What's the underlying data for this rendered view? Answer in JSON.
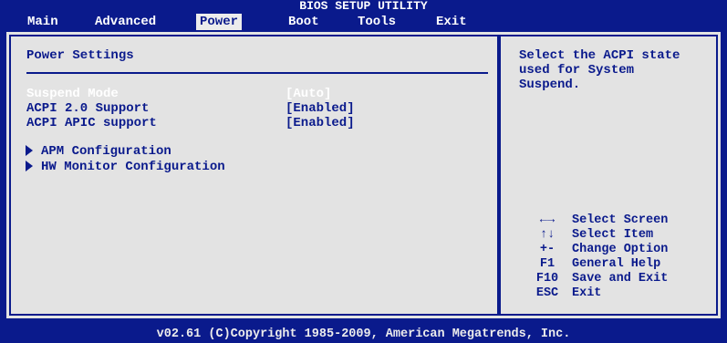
{
  "header": {
    "title": "BIOS SETUP UTILITY"
  },
  "menu": [
    {
      "label": "Main",
      "active": false
    },
    {
      "label": "Advanced",
      "active": false
    },
    {
      "label": "Power",
      "active": true
    },
    {
      "label": "Boot",
      "active": false
    },
    {
      "label": "Tools",
      "active": false
    },
    {
      "label": "Exit",
      "active": false
    }
  ],
  "main": {
    "section_title": "Power Settings",
    "settings": [
      {
        "label": "Suspend Mode",
        "value": "[Auto]",
        "selected": true
      },
      {
        "label": "ACPI 2.0 Support",
        "value": "[Enabled]",
        "selected": false
      },
      {
        "label": "ACPI APIC support",
        "value": "[Enabled]",
        "selected": false
      }
    ],
    "submenus": [
      {
        "label": "APM Configuration"
      },
      {
        "label": "HW Monitor Configuration"
      }
    ]
  },
  "help": {
    "text": "Select the ACPI state\nused for System\nSuspend.",
    "keys": [
      {
        "key": "←→",
        "desc": "Select Screen",
        "icon": "left-right-arrows-icon"
      },
      {
        "key": "↑↓",
        "desc": "Select Item",
        "icon": "up-down-arrows-icon"
      },
      {
        "key": "+-",
        "desc": "Change Option"
      },
      {
        "key": "F1",
        "desc": "General Help"
      },
      {
        "key": "F10",
        "desc": "Save and Exit"
      },
      {
        "key": "ESC",
        "desc": "Exit"
      }
    ]
  },
  "footer": {
    "text": "v02.61 (C)Copyright 1985-2009, American Megatrends, Inc."
  },
  "colors": {
    "background": "#0a1a8c",
    "panel": "#e3e3e3",
    "text": "#0a1a8c",
    "selected_text": "#ffffff"
  }
}
